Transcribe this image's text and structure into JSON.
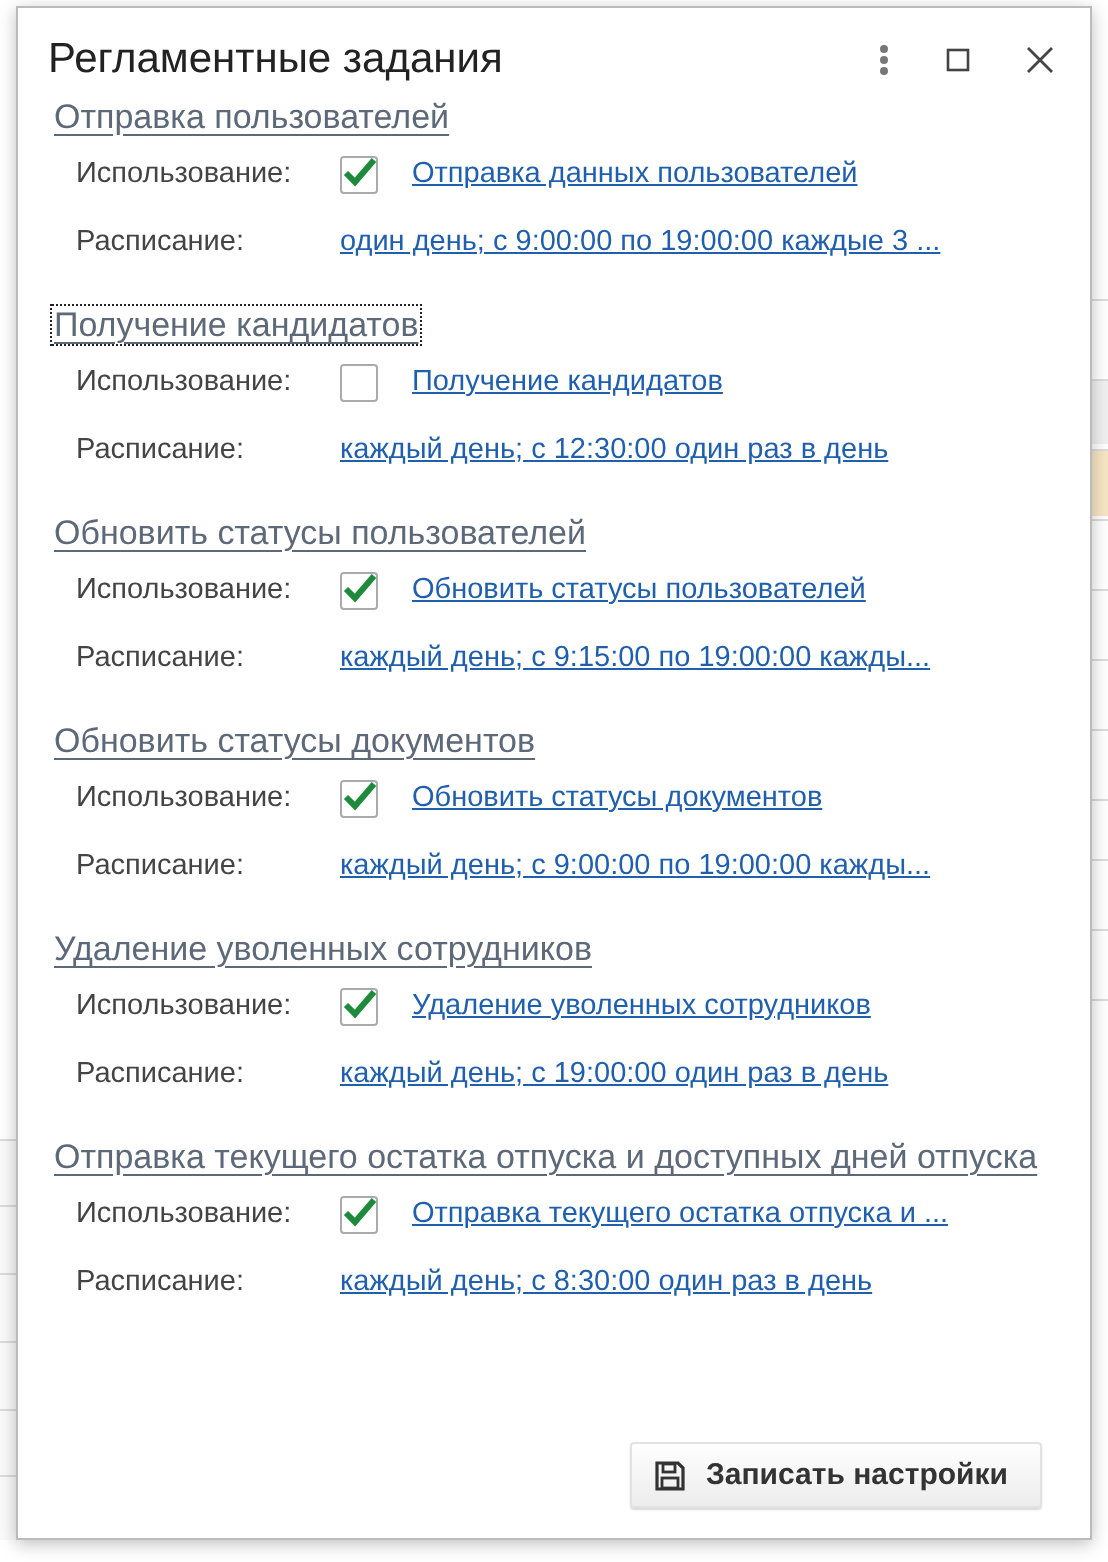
{
  "window": {
    "title": "Регламентные задания"
  },
  "sections": [
    {
      "title": "Отправка пользователей",
      "focused": false,
      "usage_label": "Использование:",
      "checked": true,
      "job_link": "Отправка данных пользователей",
      "schedule_label": "Расписание:",
      "schedule": "один день; с 9:00:00 по 19:00:00 каждые 3 ..."
    },
    {
      "title": "Получение кандидатов",
      "focused": true,
      "usage_label": "Использование:",
      "checked": false,
      "job_link": "Получение кандидатов",
      "schedule_label": "Расписание:",
      "schedule": "каждый день; с 12:30:00 один раз в день"
    },
    {
      "title": "Обновить статусы пользователей",
      "focused": false,
      "usage_label": "Использование:",
      "checked": true,
      "job_link": "Обновить статусы пользователей",
      "schedule_label": "Расписание:",
      "schedule": "каждый день; с 9:15:00 по 19:00:00 кажды..."
    },
    {
      "title": "Обновить статусы документов",
      "focused": false,
      "usage_label": "Использование:",
      "checked": true,
      "job_link": "Обновить статусы документов",
      "schedule_label": "Расписание:",
      "schedule": "каждый день; с 9:00:00 по 19:00:00 кажды..."
    },
    {
      "title": "Удаление уволенных сотрудников",
      "focused": false,
      "usage_label": "Использование:",
      "checked": true,
      "job_link": "Удаление уволенных сотрудников",
      "schedule_label": "Расписание:",
      "schedule": "каждый день; с 19:00:00 один раз в день"
    },
    {
      "title": "Отправка текущего остатка отпуска и доступных дней отпуска",
      "focused": false,
      "usage_label": "Использование:",
      "checked": true,
      "job_link": "Отправка текущего остатка отпуска и ...",
      "schedule_label": "Расписание:",
      "schedule": "каждый день; с 8:30:00 один раз в день"
    }
  ],
  "buttons": [
    {
      "label": "Записать настройки"
    }
  ]
}
